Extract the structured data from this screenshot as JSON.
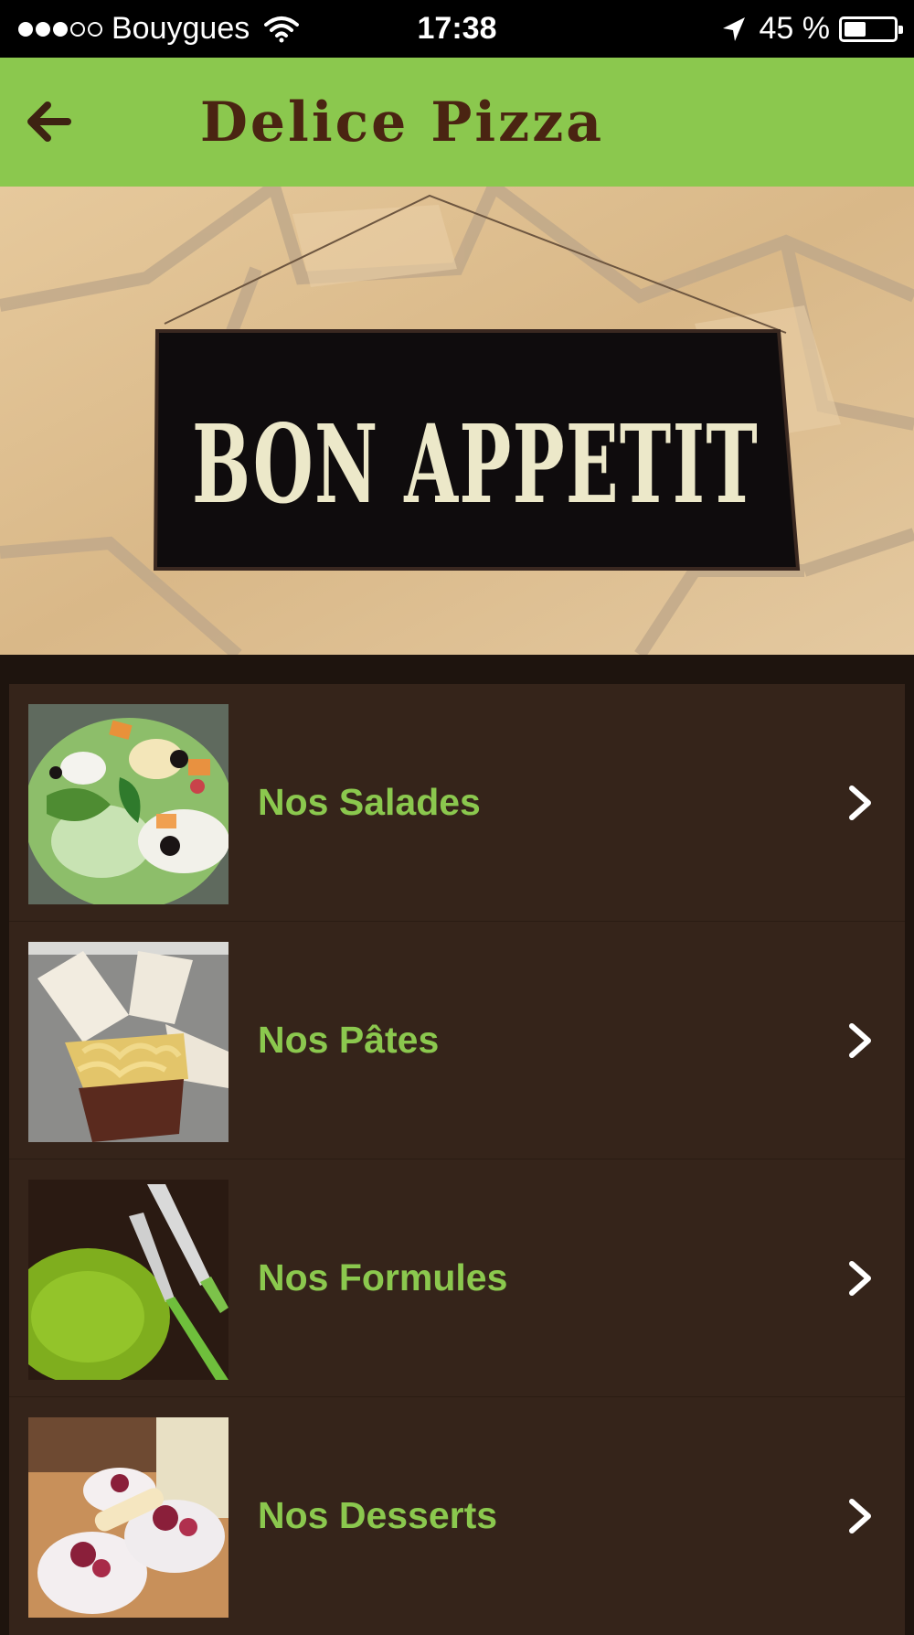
{
  "status_bar": {
    "carrier": "Bouygues",
    "signal_bars_filled": 3,
    "signal_bars_total": 5,
    "time": "17:38",
    "battery_percent": "45 %",
    "battery_level": 0.45,
    "icons": [
      "wifi-icon",
      "location-arrow-icon",
      "battery-icon"
    ]
  },
  "header": {
    "title": "Delice Pizza",
    "back_icon": "arrow-left-icon"
  },
  "hero": {
    "sign_text": "BON APPETIT"
  },
  "menu": {
    "items": [
      {
        "label": "Nos Salades",
        "thumbnail": "salad-photo",
        "icon": "chevron-right-icon"
      },
      {
        "label": "Nos Pâtes",
        "thumbnail": "pasta-box-photo",
        "icon": "chevron-right-icon"
      },
      {
        "label": "Nos Formules",
        "thumbnail": "plate-cutlery-photo",
        "icon": "chevron-right-icon"
      },
      {
        "label": "Nos Desserts",
        "thumbnail": "dessert-cups-photo",
        "icon": "chevron-right-icon"
      }
    ]
  },
  "colors": {
    "accent_green": "#8bc84e",
    "title_brown": "#4a2412",
    "list_background": "#35241a",
    "chevron": "#ffffff"
  }
}
